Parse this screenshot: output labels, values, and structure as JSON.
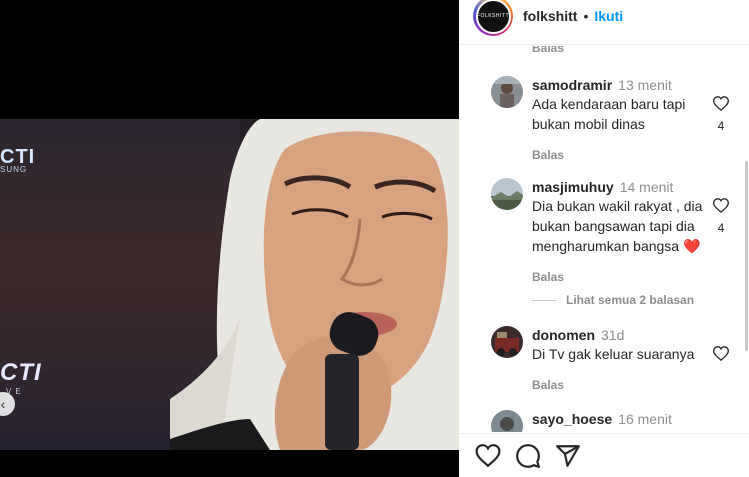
{
  "video": {
    "logo_top": "CTI",
    "logo_top_sub": "SUNG",
    "logo_mid": "CTI",
    "logo_mid_sub": "VE"
  },
  "header": {
    "avatar_text": "FOLKSHITT",
    "username": "folkshitt",
    "separator": "•",
    "follow_label": "Ikuti"
  },
  "reply_label_top": "Balas",
  "comments": [
    {
      "username": "samodramir",
      "time": "13 menit",
      "text": "Ada kendaraan baru tapi bukan mobil dinas",
      "reply_label": "Balas",
      "likes": "4"
    },
    {
      "username": "masjimuhuy",
      "time": "14 menit",
      "text": "Dia bukan wakil rakyat , dia bukan bangsawan tapi dia mengharumkan bangsa ❤️",
      "reply_label": "Balas",
      "likes": "4"
    },
    {
      "username": "donomen",
      "time": "31d",
      "text": "Di Tv gak keluar suaranya",
      "reply_label": "Balas",
      "likes": ""
    },
    {
      "username": "sayo_hoese",
      "time": "16 menit",
      "text": "",
      "reply_label": "",
      "likes": ""
    }
  ],
  "view_replies_label": "Lihat semua 2 balasan",
  "icons": {
    "like": "heart-icon",
    "comment": "comment-icon",
    "share": "send-icon",
    "prev": "chevron-left-icon"
  },
  "colors": {
    "follow": "#0095f6",
    "heart_emoji": "#e0245e",
    "muted": "#8e8e8e",
    "text": "#262626"
  }
}
